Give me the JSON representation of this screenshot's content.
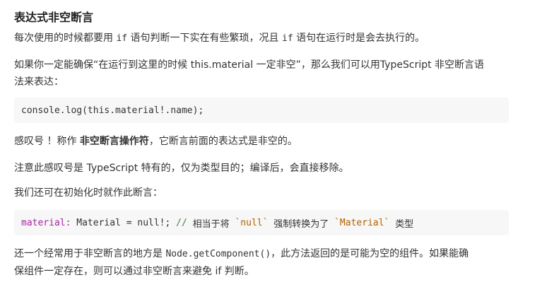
{
  "heading": "表达式非空断言",
  "p1": {
    "a": "每次使用的时候都要用 ",
    "code1": "if",
    "b": " 语句判断一下实在有些繁琐，况且 ",
    "code2": "if",
    "c": " 语句在运行时是会去执行的。"
  },
  "p2": {
    "line1": "如果你一定能确保“在运行到这里的时候 this.material 一定非空”，那么我们可以用TypeScript 非空断言语",
    "line2": "法来表达："
  },
  "code1": "console.log(this.material!.name);",
  "p3": {
    "a": "感叹号 ！称作 ",
    "bold": "非空断言操作符",
    "b": "，它断言前面的表达式是非空的。"
  },
  "p4": "注意此感叹号是 TypeScript 特有的，仅为类型目的；编译后，会直接移除。",
  "p5": "我们还可在初始化时就作此断言：",
  "code2": {
    "var": "material:",
    "rest": " Material = null!; ",
    "comment": "//",
    "c1": " 相当于将 ",
    "s1": "`null`",
    "c2": " 强制转换为了 ",
    "s2": "`Material`",
    "c3": " 类型"
  },
  "p6": {
    "a": "还一个经常用于非空断言的地方是 ",
    "code": "Node.getComponent()",
    "b": "，此方法返回的是可能为空的组件。如果能确",
    "line2": "保组件一定存在，则可以通过非空断言来避免 if 判断。"
  }
}
